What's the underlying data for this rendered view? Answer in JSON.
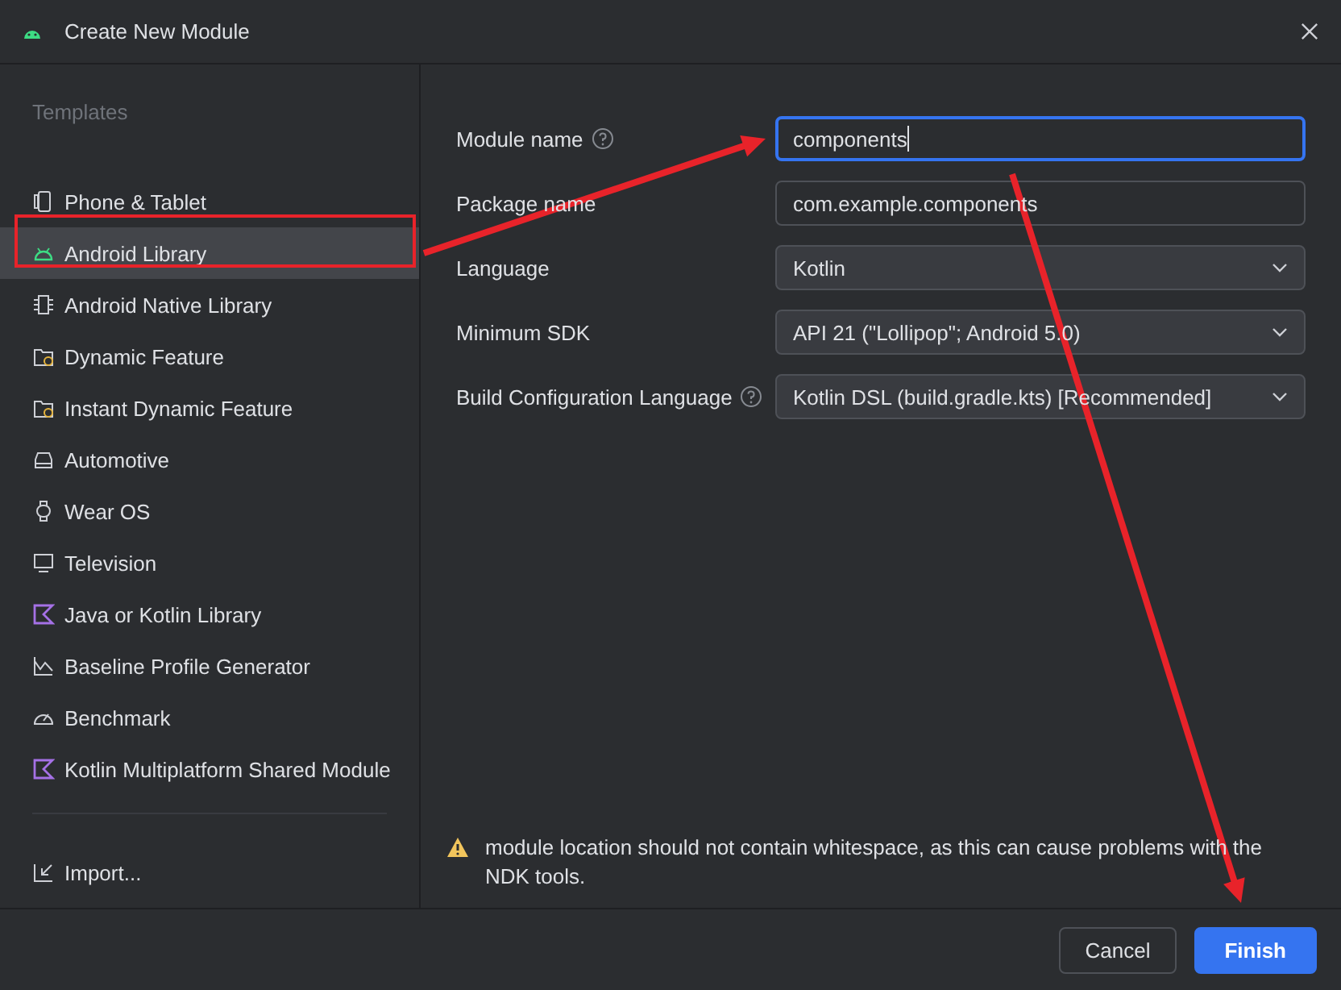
{
  "window": {
    "title": "Create New Module"
  },
  "sidebar": {
    "heading": "Templates",
    "items": [
      {
        "label": "Phone & Tablet",
        "selected": false
      },
      {
        "label": "Android Library",
        "selected": true
      },
      {
        "label": "Android Native Library",
        "selected": false
      },
      {
        "label": "Dynamic Feature",
        "selected": false
      },
      {
        "label": "Instant Dynamic Feature",
        "selected": false
      },
      {
        "label": "Automotive",
        "selected": false
      },
      {
        "label": "Wear OS",
        "selected": false
      },
      {
        "label": "Television",
        "selected": false
      },
      {
        "label": "Java or Kotlin Library",
        "selected": false
      },
      {
        "label": "Baseline Profile Generator",
        "selected": false
      },
      {
        "label": "Benchmark",
        "selected": false
      },
      {
        "label": "Kotlin Multiplatform Shared Module",
        "selected": false
      }
    ],
    "import": "Import..."
  },
  "form": {
    "fields": [
      {
        "label": "Module name",
        "help": true,
        "kind": "text",
        "value": "components",
        "focused": true
      },
      {
        "label": "Package name",
        "help": false,
        "kind": "text",
        "value": "com.example.components",
        "focused": false
      },
      {
        "label": "Language",
        "help": false,
        "kind": "dropdown",
        "value": "Kotlin",
        "focused": false
      },
      {
        "label": "Minimum SDK",
        "help": false,
        "kind": "dropdown",
        "value": "API 21 (\"Lollipop\"; Android 5.0)",
        "focused": false
      },
      {
        "label": "Build Configuration Language",
        "help": true,
        "kind": "dropdown",
        "value": "Kotlin DSL (build.gradle.kts) [Recommended]",
        "focused": false
      }
    ],
    "warning": "module location should not contain whitespace, as this can cause problems with the NDK tools."
  },
  "buttons": [
    {
      "label": "Cancel",
      "primary": false
    },
    {
      "label": "Finish",
      "primary": true
    }
  ],
  "annotations": [
    {
      "kind": "box"
    },
    {
      "kind": "arrow"
    },
    {
      "kind": "arrow"
    }
  ]
}
